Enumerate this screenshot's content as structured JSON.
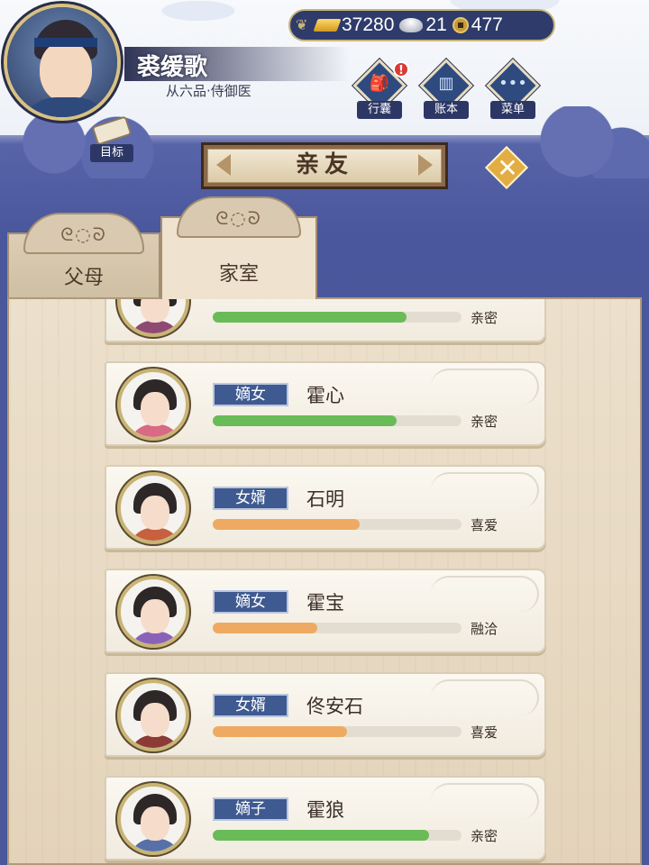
{
  "player": {
    "name": "裘缓歌",
    "rank": "从六品·侍御医"
  },
  "currency": {
    "gold": "37280",
    "silver": "21",
    "coins": "477"
  },
  "menu": {
    "bag": "行囊",
    "ledger": "账本",
    "menu": "菜单",
    "bag_alert": "!"
  },
  "goal_label": "目标",
  "title": "亲友",
  "tabs": [
    {
      "label": "父母",
      "deco": "ᘓ◌ᘐ"
    },
    {
      "label": "家室",
      "deco": "ᘓ◌ᘐ"
    }
  ],
  "members": [
    {
      "role": "",
      "name": "",
      "relation": "亲密",
      "affinity": 0.78,
      "bar_color": "green",
      "robe": "#8e4a73"
    },
    {
      "role": "嫡女",
      "name": "霍心",
      "relation": "亲密",
      "affinity": 0.74,
      "bar_color": "green",
      "robe": "#d86a83"
    },
    {
      "role": "女婿",
      "name": "石明",
      "relation": "喜爱",
      "affinity": 0.59,
      "bar_color": "orange",
      "robe": "#c6603f"
    },
    {
      "role": "嫡女",
      "name": "霍宝",
      "relation": "融洽",
      "affinity": 0.42,
      "bar_color": "orange",
      "robe": "#8a63b8"
    },
    {
      "role": "女婿",
      "name": "佟安石",
      "relation": "喜爱",
      "affinity": 0.54,
      "bar_color": "orange",
      "robe": "#8b3a36"
    },
    {
      "role": "嫡子",
      "name": "霍狼",
      "relation": "亲密",
      "affinity": 0.87,
      "bar_color": "green",
      "robe": "#5870a8"
    }
  ]
}
